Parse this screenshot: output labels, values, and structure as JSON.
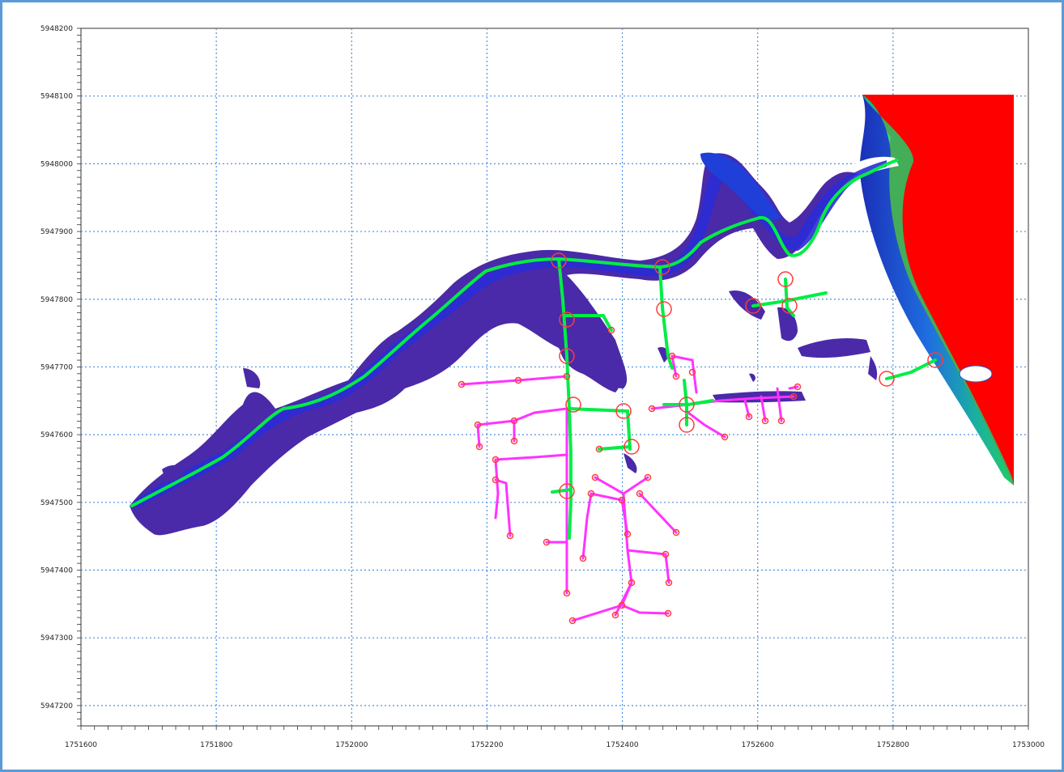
{
  "map": {
    "x_ticks": [
      "1751600",
      "1751800",
      "1752000",
      "1752200",
      "1752400",
      "1752600",
      "1752800",
      "1753000"
    ],
    "y_ticks": [
      "5948200",
      "5948100",
      "5948000",
      "5947900",
      "5947800",
      "5947700",
      "5947600",
      "5947500",
      "5947400",
      "5947300",
      "5947200"
    ],
    "grid": "dotted",
    "colors": {
      "frame": "#5b9bd5",
      "grid": "#4a90e2",
      "sea": "#ff0000",
      "river_deep": "#3b2bb0",
      "river_shallow": "#5a2ca0",
      "coast_blue": "#1e4fd8",
      "coast_green": "#1faa6a",
      "channel_1d": "#00ee44",
      "pipe_network": "#ff33ff",
      "node_marker": "#ff3b3b"
    }
  }
}
